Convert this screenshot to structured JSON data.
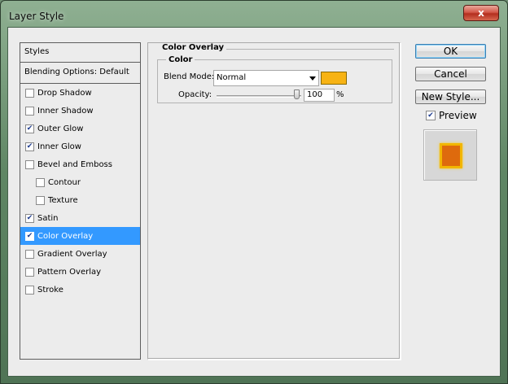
{
  "window": {
    "title": "Layer Style",
    "close_label": "x"
  },
  "styles_panel": {
    "header": "Styles",
    "blending_options": "Blending Options: Default",
    "items": [
      {
        "label": "Drop Shadow",
        "checked": false,
        "indent": false,
        "selected": false
      },
      {
        "label": "Inner Shadow",
        "checked": false,
        "indent": false,
        "selected": false
      },
      {
        "label": "Outer Glow",
        "checked": true,
        "indent": false,
        "selected": false
      },
      {
        "label": "Inner Glow",
        "checked": true,
        "indent": false,
        "selected": false
      },
      {
        "label": "Bevel and Emboss",
        "checked": false,
        "indent": false,
        "selected": false
      },
      {
        "label": "Contour",
        "checked": false,
        "indent": true,
        "selected": false
      },
      {
        "label": "Texture",
        "checked": false,
        "indent": true,
        "selected": false
      },
      {
        "label": "Satin",
        "checked": true,
        "indent": false,
        "selected": false
      },
      {
        "label": "Color Overlay",
        "checked": true,
        "indent": false,
        "selected": true
      },
      {
        "label": "Gradient Overlay",
        "checked": false,
        "indent": false,
        "selected": false
      },
      {
        "label": "Pattern Overlay",
        "checked": false,
        "indent": false,
        "selected": false
      },
      {
        "label": "Stroke",
        "checked": false,
        "indent": false,
        "selected": false
      }
    ]
  },
  "color_overlay": {
    "group_title": "Color Overlay",
    "subgroup_title": "Color",
    "blend_mode_label": "Blend Mode:",
    "blend_mode_value": "Normal",
    "overlay_color": "#f7b314",
    "opacity_label": "Opacity:",
    "opacity_value": "100",
    "opacity_unit": "%",
    "opacity_level": 1.0
  },
  "buttons": {
    "ok": "OK",
    "cancel": "Cancel",
    "new_style": "New Style..."
  },
  "preview": {
    "label": "Preview",
    "checked": true,
    "swatch_fill": "#de6a0d",
    "swatch_border": "#f2b600"
  },
  "colors": {
    "selection": "#3399ff",
    "dialog_bg": "#ececec"
  }
}
